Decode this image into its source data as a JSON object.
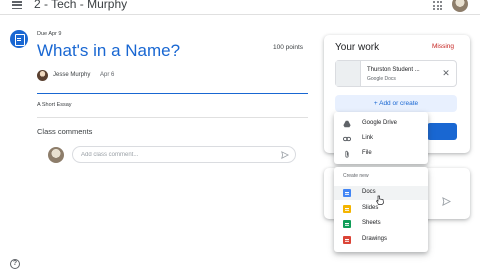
{
  "header": {
    "class_title": "2 - Tech - Murphy"
  },
  "assignment": {
    "due": "Due Apr 9",
    "title": "What's in a Name?",
    "points": "100 points",
    "author": "Jesse Murphy",
    "posted_date": "Apr 6",
    "description": "A Short Essay"
  },
  "comments": {
    "heading": "Class comments",
    "placeholder": "Add class comment..."
  },
  "your_work": {
    "title": "Your work",
    "status": "Missing",
    "attachment": {
      "name": "Thurston Student ...",
      "type": "Google Docs"
    },
    "add_create_label": "+ Add or create"
  },
  "add_menu": {
    "items": [
      "Google Drive",
      "Link",
      "File"
    ]
  },
  "create_menu": {
    "label": "Create new",
    "items": [
      "Docs",
      "Slides",
      "Sheets",
      "Drawings"
    ]
  },
  "colors": {
    "accent": "#1967d2",
    "missing": "#c5221f",
    "docs": "#4285f4",
    "slides": "#f4b400",
    "sheets": "#0f9d58",
    "drawings": "#db4437"
  }
}
